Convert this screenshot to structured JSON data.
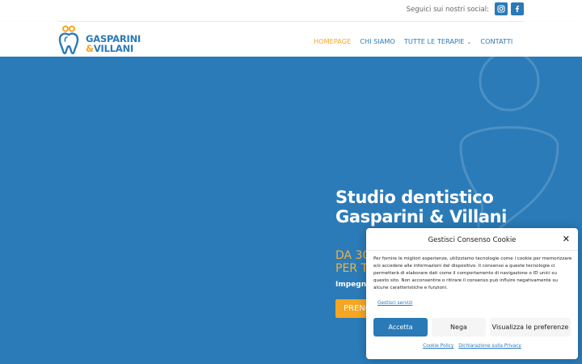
{
  "topbar": {
    "social_label": "Seguici sui nostri social:",
    "social_icons": [
      "instagram-icon",
      "facebook-icon"
    ]
  },
  "header": {
    "logo": {
      "line1": "GASPARINI",
      "line2_amp": "&",
      "line2": "VILLANI"
    },
    "nav": [
      {
        "label": "HOMEPAGE",
        "active": true
      },
      {
        "label": "CHI SIAMO",
        "active": false
      },
      {
        "label": "TUTTE LE TERAPIE",
        "active": false,
        "has_dropdown": true
      },
      {
        "label": "CONTATTI",
        "active": false
      }
    ]
  },
  "hero": {
    "title": "Studio dentistico Gasparini & Villani",
    "subtitle": "DA 30 ANNI AL SERVIZIO PER TUTTA LA FAMIGLIA",
    "description": "Impegno, professionalità e competenza",
    "cta_label": "PRENOTA UNA VISITA"
  },
  "cookie_banner": {
    "title": "Gestisci Consenso Cookie",
    "body": "Per fornire le migliori esperienze, utilizziamo tecnologie come i cookie per memorizzare e/o accedere alle informazioni del dispositivo. Il consenso a queste tecnologie ci permetterà di elaborare dati come il comportamento di navigazione o ID unici su questo sito. Non acconsentire o ritirare il consenso può influire negativamente su alcune caratteristiche e funzioni.",
    "manage_link": "Gestisci servizi",
    "accept_label": "Accetta",
    "deny_label": "Nega",
    "preferences_label": "Visualizza le preferenze",
    "cookie_policy_link": "Cookie Policy",
    "privacy_link": "Dichiarazione sulla Privacy"
  },
  "colors": {
    "brand_blue": "#2a7ab7",
    "hero_blue": "#2b7bb8",
    "accent_orange": "#f5a623"
  }
}
